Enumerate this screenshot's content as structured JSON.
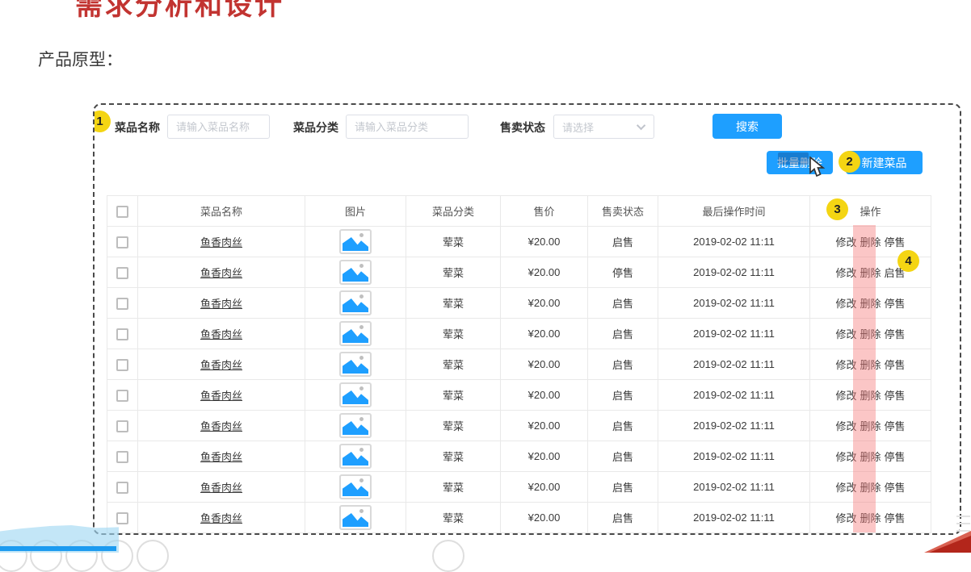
{
  "page": {
    "title": "需求分析和设计",
    "subtitle": "产品原型："
  },
  "search_form": {
    "fields": [
      {
        "label": "菜品名称",
        "placeholder": "请输入菜品名称",
        "type": "input"
      },
      {
        "label": "菜品分类",
        "placeholder": "请输入菜品分类",
        "type": "input"
      },
      {
        "label": "售卖状态",
        "placeholder": "请选择",
        "type": "select"
      }
    ],
    "search_label": "搜索"
  },
  "toolbar": {
    "batch_delete_label": "批量删除",
    "new_dish_label": "新建菜品"
  },
  "annotations": {
    "markers": [
      "1",
      "2",
      "3",
      "4"
    ],
    "marker_color": "#F4D513",
    "delete_column_highlight_color": "#F67676"
  },
  "table": {
    "headers": [
      "菜品名称",
      "图片",
      "菜品分类",
      "售价",
      "售卖状态",
      "最后操作时间",
      "操作"
    ],
    "image_icon": "image-placeholder-icon",
    "rows": [
      {
        "name": "鱼香肉丝",
        "category": "荤菜",
        "price": "¥20.00",
        "status": "启售",
        "time": "2019-02-02 11:11",
        "actions": [
          "修改",
          "删除",
          "停售"
        ]
      },
      {
        "name": "鱼香肉丝",
        "category": "荤菜",
        "price": "¥20.00",
        "status": "停售",
        "time": "2019-02-02 11:11",
        "actions": [
          "修改",
          "删除",
          "启售"
        ]
      },
      {
        "name": "鱼香肉丝",
        "category": "荤菜",
        "price": "¥20.00",
        "status": "启售",
        "time": "2019-02-02 11:11",
        "actions": [
          "修改",
          "删除",
          "停售"
        ]
      },
      {
        "name": "鱼香肉丝",
        "category": "荤菜",
        "price": "¥20.00",
        "status": "启售",
        "time": "2019-02-02 11:11",
        "actions": [
          "修改",
          "删除",
          "停售"
        ]
      },
      {
        "name": "鱼香肉丝",
        "category": "荤菜",
        "price": "¥20.00",
        "status": "启售",
        "time": "2019-02-02 11:11",
        "actions": [
          "修改",
          "删除",
          "停售"
        ]
      },
      {
        "name": "鱼香肉丝",
        "category": "荤菜",
        "price": "¥20.00",
        "status": "启售",
        "time": "2019-02-02 11:11",
        "actions": [
          "修改",
          "删除",
          "停售"
        ]
      },
      {
        "name": "鱼香肉丝",
        "category": "荤菜",
        "price": "¥20.00",
        "status": "启售",
        "time": "2019-02-02 11:11",
        "actions": [
          "修改",
          "删除",
          "停售"
        ]
      },
      {
        "name": "鱼香肉丝",
        "category": "荤菜",
        "price": "¥20.00",
        "status": "启售",
        "time": "2019-02-02 11:11",
        "actions": [
          "修改",
          "删除",
          "停售"
        ]
      },
      {
        "name": "鱼香肉丝",
        "category": "荤菜",
        "price": "¥20.00",
        "status": "启售",
        "time": "2019-02-02 11:11",
        "actions": [
          "修改",
          "删除",
          "停售"
        ]
      },
      {
        "name": "鱼香肉丝",
        "category": "荤菜",
        "price": "¥20.00",
        "status": "启售",
        "time": "2019-02-02 11:11",
        "actions": [
          "修改",
          "删除",
          "停售"
        ]
      }
    ]
  },
  "colors": {
    "primary_blue": "#1E9FFF",
    "heading_red": "#C23431",
    "corner_red": "#B3261B"
  }
}
